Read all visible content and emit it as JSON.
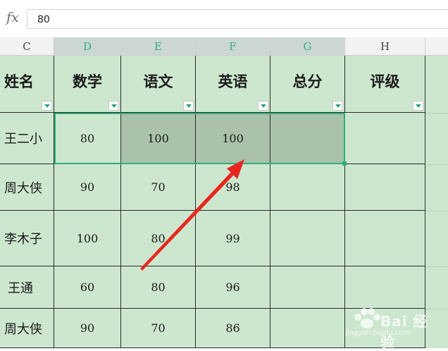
{
  "formula_bar": {
    "fx_label": "fx",
    "value": "80"
  },
  "columns": [
    "C",
    "D",
    "E",
    "F",
    "G",
    "H"
  ],
  "headers": [
    "姓名",
    "数学",
    "语文",
    "英语",
    "总分",
    "评级"
  ],
  "rows": [
    {
      "name": "王二小",
      "math": "80",
      "chinese": "100",
      "english": "100",
      "total": "",
      "grade": ""
    },
    {
      "name": "周大侠",
      "math": "90",
      "chinese": "70",
      "english": "98",
      "total": "",
      "grade": ""
    },
    {
      "name": "李木子",
      "math": "100",
      "chinese": "80",
      "english": "99",
      "total": "",
      "grade": ""
    },
    {
      "name": "王通",
      "math": "60",
      "chinese": "80",
      "english": "96",
      "total": "",
      "grade": ""
    },
    {
      "name": "周大侠",
      "math": "90",
      "chinese": "70",
      "english": "86",
      "total": "",
      "grade": ""
    }
  ],
  "watermark": {
    "brand": "Bai 经验",
    "url": "jingyan.baidu.com"
  },
  "colors": {
    "sheet_fill": "#cde7cf",
    "selected_fill": "#a9c2a9",
    "selection_border": "#2db07a",
    "arrow": "#e8261f"
  }
}
